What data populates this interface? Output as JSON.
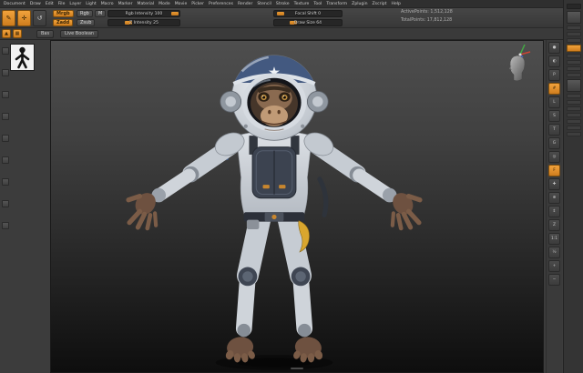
{
  "menubar": {
    "items": [
      "Document",
      "Draw",
      "Edit",
      "File",
      "Layer",
      "Light",
      "Macro",
      "Marker",
      "Material",
      "Mode",
      "Movie",
      "Picker",
      "Preferences",
      "Render",
      "Stencil",
      "Stroke",
      "Texture",
      "Tool",
      "Transform",
      "Zplugin",
      "Zscript",
      "Help"
    ]
  },
  "shelf1": {
    "left_icons": [
      {
        "name": "sculpt-brush-icon-button",
        "glyph": "✎",
        "active": true
      },
      {
        "name": "color-paint-icon-button",
        "glyph": "✛",
        "active": true
      },
      {
        "name": "history-icon-button",
        "glyph": "↺",
        "active": false
      }
    ],
    "mrgb_label": "Mrgb",
    "rgb_label": "Rgb",
    "m_label": "M",
    "rgb_intensity": {
      "label": "Rgb Intensity",
      "value": "100",
      "pct": 100
    },
    "zadd_label": "Zadd",
    "zsub_label": "Zsub",
    "z_intensity": {
      "label": "Z Intensity",
      "value": "25",
      "pct": 25
    },
    "focal_shift": {
      "label": "Focal Shift",
      "value": "0",
      "pct": 3
    },
    "draw_size": {
      "label": "Draw Size",
      "value": "64",
      "pct": 25
    },
    "active_points": "ActivePoints: 1,512,128",
    "total_points": "TotalPoints: 17,812,128"
  },
  "shelf2": {
    "icons": [
      {
        "name": "sculptris-pro-icon-button",
        "glyph": "▲"
      },
      {
        "name": "dynamic-subdiv-icon-button",
        "glyph": "▦"
      }
    ],
    "bas_label": "Bas",
    "live_boolean_label": "Live Boolean"
  },
  "left_shelf": {
    "items": [
      {
        "name": "brush-thumbnail"
      },
      {
        "name": "stroke-thumbnail"
      },
      {
        "name": "alpha-thumbnail"
      },
      {
        "name": "texture-thumbnail"
      },
      {
        "name": "material-thumbnail"
      },
      {
        "name": "gradient-swatch"
      },
      {
        "name": "color-swatch"
      },
      {
        "name": "switch-color-button"
      },
      {
        "name": "pick-color-button"
      }
    ]
  },
  "right_shelf": {
    "items": [
      {
        "name": "bpr-render-button",
        "glyph": "●",
        "active": false
      },
      {
        "name": "render-mode-button",
        "glyph": "◐",
        "active": false
      },
      {
        "name": "persp-button",
        "glyph": "P",
        "active": false
      },
      {
        "name": "floor-grid-button",
        "glyph": "#",
        "active": true
      },
      {
        "name": "local-transform-button",
        "glyph": "L",
        "active": false
      },
      {
        "name": "lsym-button",
        "glyph": "S",
        "active": false
      },
      {
        "name": "transparency-button",
        "glyph": "T",
        "active": false
      },
      {
        "name": "ghost-button",
        "glyph": "G",
        "active": false
      },
      {
        "name": "solo-button",
        "glyph": "◎",
        "active": false
      },
      {
        "name": "frame-button",
        "glyph": "F",
        "active": true
      },
      {
        "name": "move-canvas-button",
        "glyph": "✚",
        "active": false
      },
      {
        "name": "zoom3d-button",
        "glyph": "⊕",
        "active": false
      },
      {
        "name": "scroll-button",
        "glyph": "⇕",
        "active": false
      },
      {
        "name": "zoom-button",
        "glyph": "Z",
        "active": false
      },
      {
        "name": "actual-size-button",
        "glyph": "1:1",
        "active": false
      },
      {
        "name": "aa-half-button",
        "glyph": "½",
        "active": false
      },
      {
        "name": "zoom-in-button",
        "glyph": "+",
        "active": false
      },
      {
        "name": "zoom-out-button",
        "glyph": "−",
        "active": false
      }
    ]
  },
  "right_panel": {
    "rows": [
      {
        "name": "tool-palette-header",
        "type": "hdr"
      },
      {
        "name": "active-tool-thumbnail",
        "type": "thumb"
      },
      {
        "name": "subtool-row",
        "type": "row"
      },
      {
        "name": "subtool-row",
        "type": "row"
      },
      {
        "name": "subtool-row",
        "type": "row"
      },
      {
        "name": "make-polymesh-button",
        "type": "orange"
      },
      {
        "name": "geometry-row",
        "type": "row"
      },
      {
        "name": "geometry-row",
        "type": "row"
      },
      {
        "name": "geometry-row",
        "type": "row"
      },
      {
        "name": "geometry-row",
        "type": "row"
      },
      {
        "name": "subtool-thumbnail",
        "type": "thumb"
      },
      {
        "name": "panel-row",
        "type": "row"
      },
      {
        "name": "panel-row",
        "type": "row"
      },
      {
        "name": "panel-row",
        "type": "row"
      },
      {
        "name": "panel-row",
        "type": "row"
      },
      {
        "name": "panel-row",
        "type": "row"
      },
      {
        "name": "panel-row",
        "type": "row"
      },
      {
        "name": "panel-row",
        "type": "row"
      }
    ]
  },
  "canvas": {
    "model": "chimp-astronaut",
    "colors": {
      "helmet": "#c2c8cf",
      "visor": "#141519",
      "dome": "#435980",
      "suit": "#cfd4da",
      "chest_plate": "#3c4350",
      "skin": "#6e5140",
      "muzzle": "#c09a76",
      "banana": "#d9a62e",
      "accent": "#e08a2e"
    }
  }
}
